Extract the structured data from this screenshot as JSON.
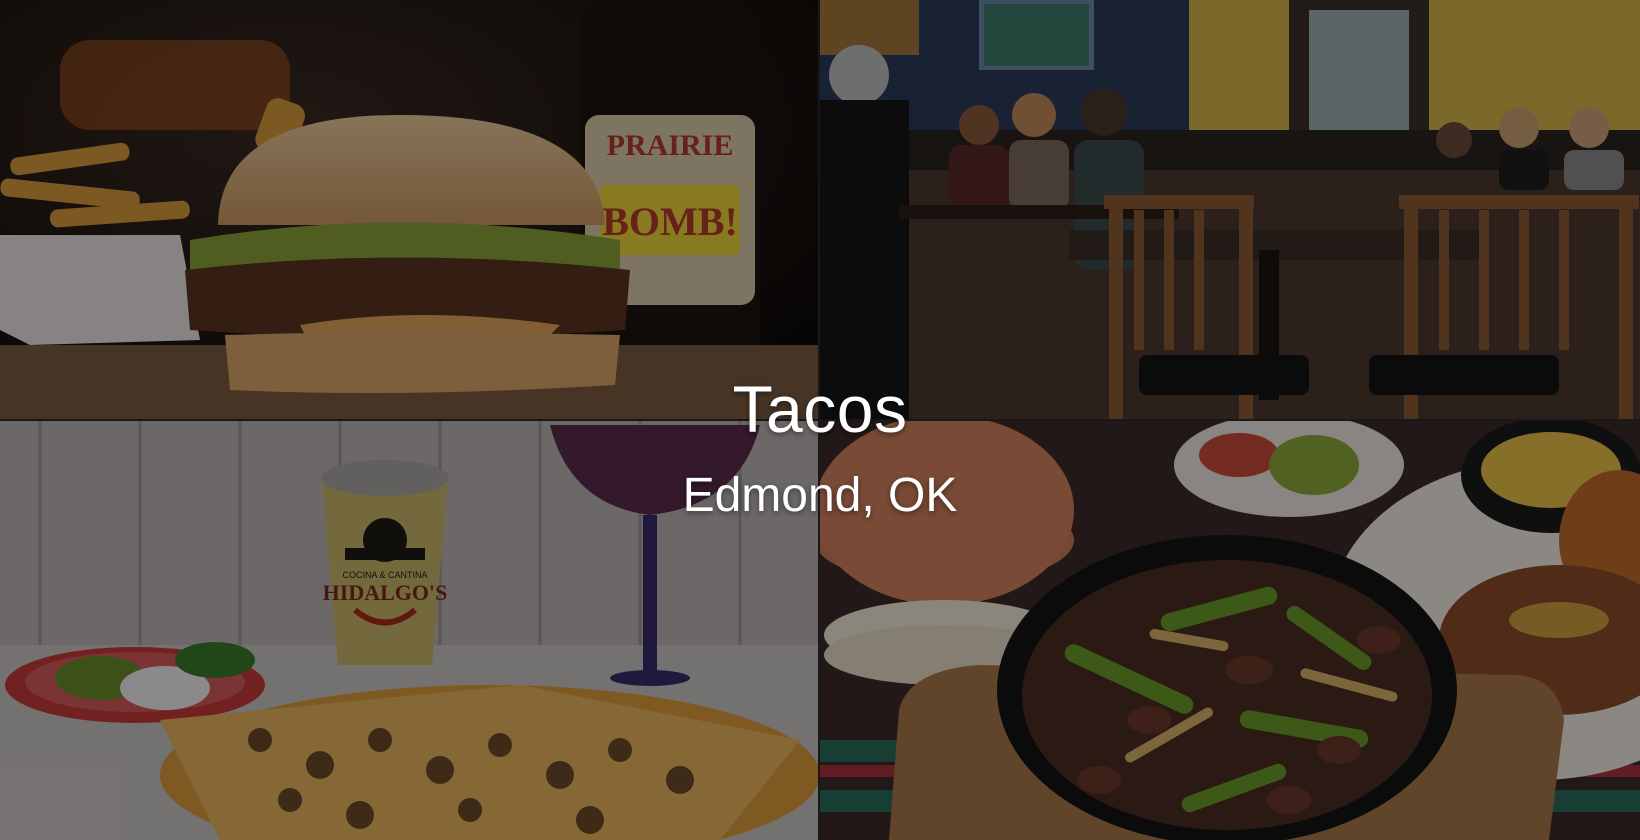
{
  "hero": {
    "title": "Tacos",
    "subtitle": "Edmond, OK"
  },
  "tiles": [
    {
      "name": "burger-photo",
      "content": "burger-with-fries-and-bottle"
    },
    {
      "name": "dining-room-photo",
      "content": "restaurant-interior-with-diners"
    },
    {
      "name": "nachos-photo",
      "content": "nachos-drink-margarita"
    },
    {
      "name": "fajitas-photo",
      "content": "skillet-fajitas-tortillas-rice-beans"
    }
  ],
  "photo_texts": {
    "bottle_label_top": "PRAIRIE",
    "bottle_label_mid": "BOMB!",
    "cup_brand_small": "COCINA & CANTINA",
    "cup_brand": "HIDALGO'S"
  },
  "colors": {
    "overlay": "#000000",
    "text": "#ffffff"
  }
}
